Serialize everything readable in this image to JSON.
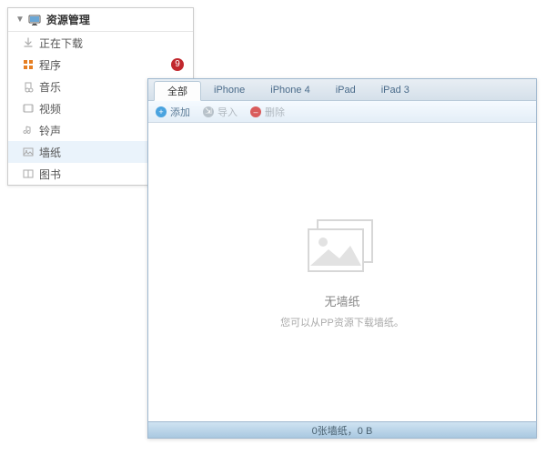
{
  "sidebar": {
    "title": "资源管理",
    "items": [
      {
        "label": "正在下载",
        "icon": "download"
      },
      {
        "label": "程序",
        "icon": "app",
        "badge": "9"
      },
      {
        "label": "音乐",
        "icon": "music"
      },
      {
        "label": "视频",
        "icon": "video"
      },
      {
        "label": "铃声",
        "icon": "ringtone"
      },
      {
        "label": "墙纸",
        "icon": "wallpaper",
        "selected": true
      },
      {
        "label": "图书",
        "icon": "book"
      }
    ]
  },
  "panel": {
    "tabs": [
      {
        "label": "全部",
        "active": true
      },
      {
        "label": "iPhone"
      },
      {
        "label": "iPhone 4"
      },
      {
        "label": "iPad"
      },
      {
        "label": "iPad 3"
      }
    ],
    "toolbar": {
      "add": "添加",
      "import": "导入",
      "delete": "删除"
    },
    "empty": {
      "title": "无墙纸",
      "subtitle": "您可以从PP资源下载墙纸。"
    },
    "status": "0张墙纸，0 B"
  }
}
